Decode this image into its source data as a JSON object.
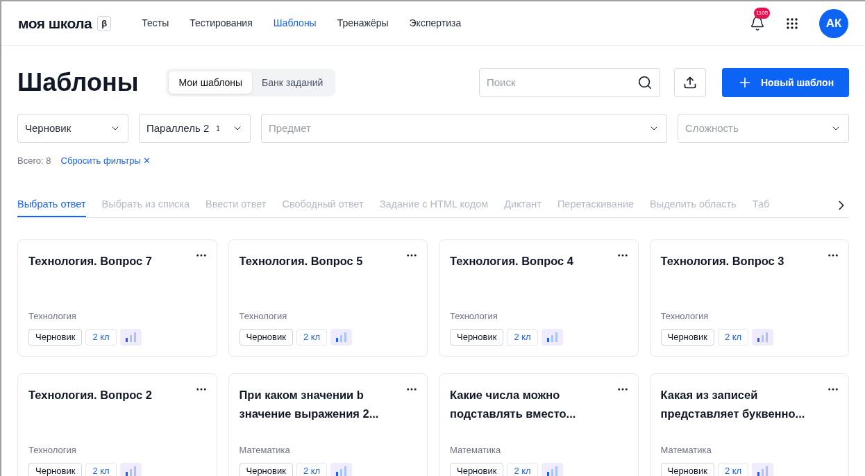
{
  "header": {
    "logo": "моя школа",
    "beta": "β",
    "nav": [
      {
        "label": "Тесты",
        "selected": false
      },
      {
        "label": "Тестирования",
        "selected": false
      },
      {
        "label": "Шаблоны",
        "selected": true
      },
      {
        "label": "Тренажёры",
        "selected": false
      },
      {
        "label": "Экспертиза",
        "selected": false
      }
    ],
    "notifications": "1105",
    "avatar": "АК"
  },
  "page": {
    "title": "Шаблоны",
    "segments": [
      {
        "label": "Мои шаблоны",
        "selected": true
      },
      {
        "label": "Банк заданий",
        "selected": false
      }
    ],
    "search": {
      "placeholder": "Поиск"
    },
    "new_button": "Новый шаблон"
  },
  "filters": [
    {
      "value": "Черновик"
    },
    {
      "value": "Параллель 2",
      "count": "1"
    },
    {
      "placeholder": "Предмет"
    },
    {
      "placeholder": "Сложность"
    }
  ],
  "summary": {
    "total": "Всего: 8",
    "reset": "Сбросить фильтры",
    "reset_icon": "✕"
  },
  "type_tabs": [
    {
      "label": "Выбрать ответ",
      "selected": true
    },
    {
      "label": "Выбрать из списка",
      "selected": false
    },
    {
      "label": "Ввести ответ",
      "selected": false
    },
    {
      "label": "Свободный ответ",
      "selected": false
    },
    {
      "label": "Задание с HTML кодом",
      "selected": false
    },
    {
      "label": "Диктант",
      "selected": false
    },
    {
      "label": "Перетаскивание",
      "selected": false
    },
    {
      "label": "Выделить область",
      "selected": false
    },
    {
      "label": "Таб",
      "selected": false
    }
  ],
  "cards": [
    {
      "title": "Технология. Вопрос 7",
      "subject": "Технология",
      "status": "Черновик",
      "grade": "2 кл",
      "level": 0.33
    },
    {
      "title": "Технология. Вопрос 5",
      "subject": "Технология",
      "status": "Черновик",
      "grade": "2 кл",
      "level": 0.33
    },
    {
      "title": "Технология. Вопрос 4",
      "subject": "Технология",
      "status": "Черновик",
      "grade": "2 кл",
      "level": 0.33
    },
    {
      "title": "Технология. Вопрос 3",
      "subject": "Технология",
      "status": "Черновик",
      "grade": "2 кл",
      "level": 0.33
    },
    {
      "title": "Технология. Вопрос 2",
      "subject": "Технология",
      "status": "Черновик",
      "grade": "2 кл",
      "level": 0.33
    },
    {
      "title": "При каком значении b значение выражения 2...",
      "subject": "Математика",
      "status": "Черновик",
      "grade": "2 кл",
      "level": 0.33
    },
    {
      "title": "Какие числа можно подставлять вместо...",
      "subject": "Математика",
      "status": "Черновик",
      "grade": "2 кл",
      "level": 0.33
    },
    {
      "title": "Какая из записей представляет буквенно...",
      "subject": "Математика",
      "status": "Черновик",
      "grade": "2 кл",
      "level": 0.33
    }
  ]
}
